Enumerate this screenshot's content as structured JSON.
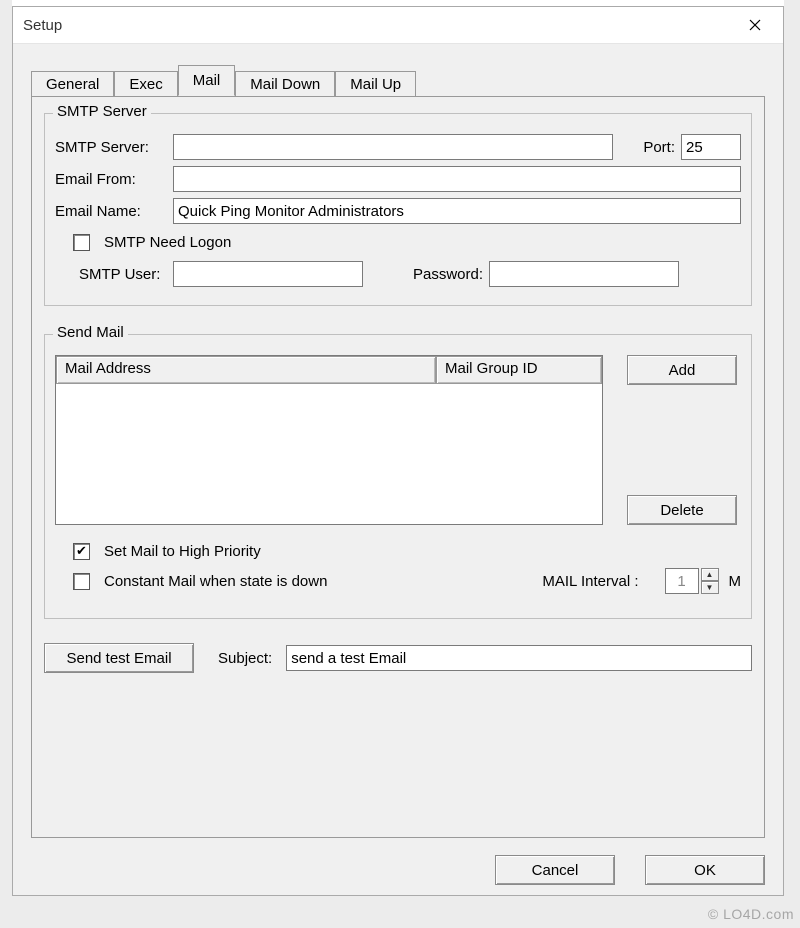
{
  "window": {
    "title": "Setup"
  },
  "tabs": [
    {
      "label": "General"
    },
    {
      "label": "Exec"
    },
    {
      "label": "Mail"
    },
    {
      "label": "Mail Down"
    },
    {
      "label": "Mail Up"
    }
  ],
  "active_tab": 2,
  "smtp": {
    "legend": "SMTP Server",
    "server_label": "SMTP Server:",
    "server_value": "",
    "port_label": "Port:",
    "port_value": "25",
    "from_label": "Email From:",
    "from_value": "",
    "name_label": "Email Name:",
    "name_value": "Quick Ping Monitor Administrators",
    "need_logon_label": "SMTP Need Logon",
    "need_logon_checked": false,
    "user_label": "SMTP User:",
    "user_value": "",
    "password_label": "Password:",
    "password_value": ""
  },
  "sendmail": {
    "legend": "Send Mail",
    "col_address": "Mail Address",
    "col_group": "Mail Group ID",
    "rows": [],
    "add_label": "Add",
    "delete_label": "Delete",
    "high_priority_label": "Set Mail to High Priority",
    "high_priority_checked": true,
    "constant_label": "Constant Mail when state is down",
    "constant_checked": false,
    "interval_label": "MAIL Interval :",
    "interval_value": "1",
    "interval_unit": "M"
  },
  "test": {
    "button_label": "Send test Email",
    "subject_label": "Subject:",
    "subject_value": "send a test Email"
  },
  "dialog": {
    "cancel": "Cancel",
    "ok": "OK"
  },
  "watermark": "© LO4D.com"
}
